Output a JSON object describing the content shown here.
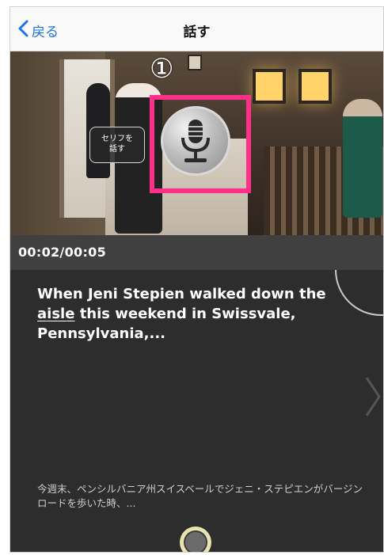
{
  "nav": {
    "back_label": "戻る",
    "title": "話す"
  },
  "video": {
    "overlay_chip_text": "セリフを\n話す",
    "step_number": "①",
    "highlight_color": "#ff2f8a"
  },
  "timebar": {
    "time": "00:02/00:05"
  },
  "content": {
    "sentence_part1": "When Jeni Stepien walked down the ",
    "sentence_underlined": "aisle",
    "sentence_part2": " this weekend in Swissvale, Pennsylvania,...",
    "translation": "今週末、ペンシルバニア州スイスベールでジェニ・ステピエンがバージンロードを歩いた時、..."
  },
  "icons": {
    "back": "chevron-left-icon",
    "mic": "microphone-icon",
    "next": "chevron-right-icon",
    "record": "record-button-icon"
  }
}
